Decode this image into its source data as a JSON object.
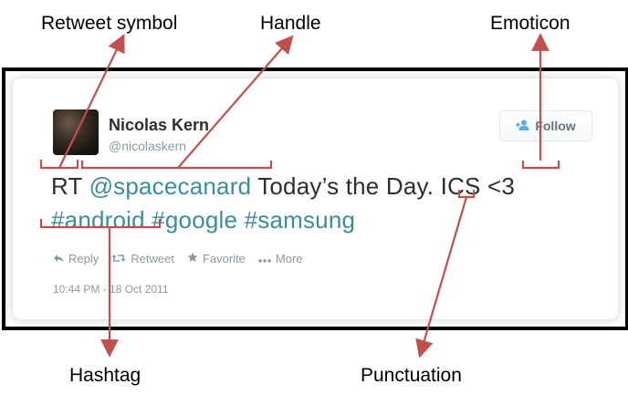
{
  "callouts": {
    "retweet_symbol": "Retweet symbol",
    "handle": "Handle",
    "emoticon": "Emoticon",
    "hashtag": "Hashtag",
    "punctuation": "Punctuation"
  },
  "tweet": {
    "author_name": "Nicolas Kern",
    "author_handle": "@nicolaskern",
    "follow_label": "Follow",
    "rt": "RT",
    "mention": "@spacecanard",
    "text_middle": " Today’s the Day",
    "punct": ".",
    "text_end": " ICS <3",
    "hashtags": [
      "#android",
      "#google",
      "#samsung"
    ],
    "actions": [
      "Reply",
      "Retweet",
      "Favorite",
      "More"
    ],
    "timestamp": "10:44 PM - 18 Oct 2011"
  },
  "colors": {
    "annotation": "#c0504d",
    "link": "#3b8d99"
  },
  "icons": [
    "user-plus-icon",
    "reply-icon",
    "retweet-icon",
    "star-icon",
    "more-icon"
  ]
}
